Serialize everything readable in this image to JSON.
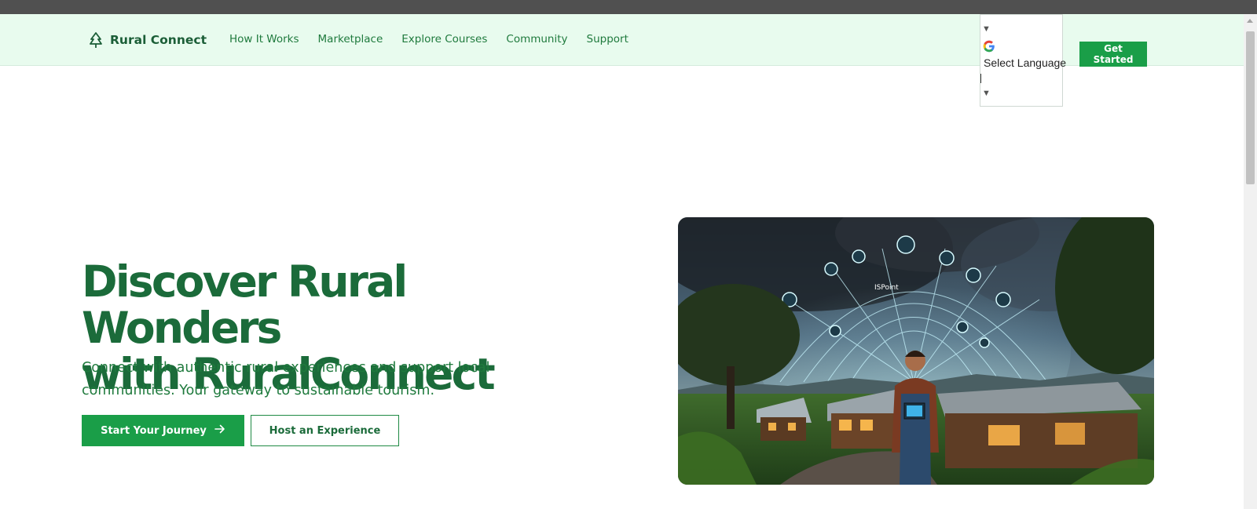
{
  "brand": {
    "name": "Rural Connect",
    "icon": "tree-icon"
  },
  "nav": {
    "links": [
      "How It Works",
      "Marketplace",
      "Explore Courses",
      "Community",
      "Support"
    ]
  },
  "language": {
    "label": "Select Language",
    "icon": "google-g-icon"
  },
  "header": {
    "cta_label": "Get Started"
  },
  "hero": {
    "title_line1": "Discover Rural Wonders",
    "title_line2": "with RuralConnect",
    "subtitle_line1": "Connect with authentic rural experiences and support local",
    "subtitle_line2": "communities. Your gateway to sustainable tourism.",
    "primary_button": "Start Your Journey",
    "secondary_button": "Host an Experience",
    "image_label": "ISPoint"
  },
  "colors": {
    "brand_green": "#1b6b3a",
    "accent_green": "#1a9e48",
    "nav_background": "#e8fbee"
  }
}
